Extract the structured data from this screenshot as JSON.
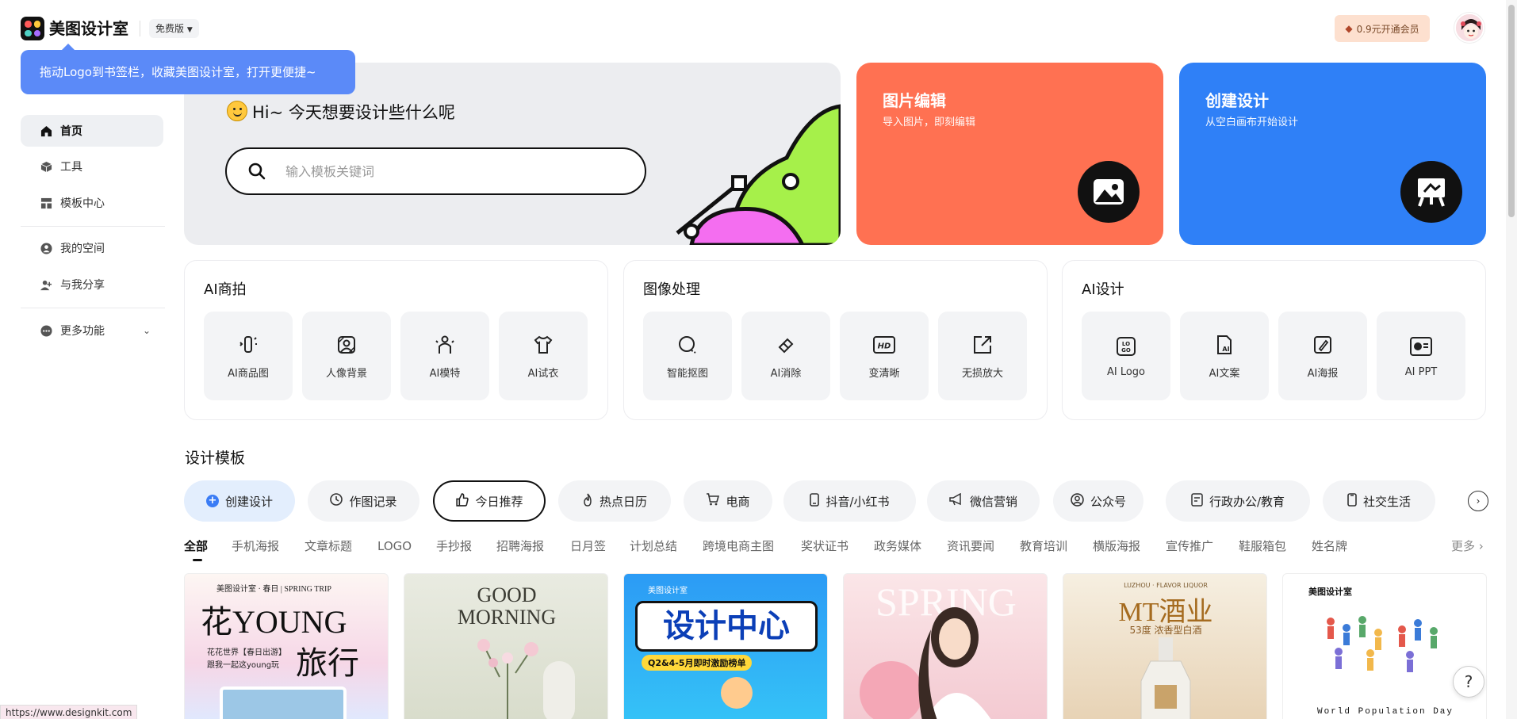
{
  "header": {
    "app_name": "美图设计室",
    "plan_badge": "免费版",
    "vip_button": "0.9元开通会员",
    "tooltip": "拖动Logo到书签栏，收藏美图设计室，打开更便捷~"
  },
  "sidebar": {
    "items": [
      {
        "label": "首页",
        "icon": "home-icon",
        "active": true
      },
      {
        "label": "工具",
        "icon": "cube-icon",
        "active": false
      },
      {
        "label": "模板中心",
        "icon": "layout-icon",
        "active": false
      },
      {
        "label": "我的空间",
        "icon": "user-circle-icon",
        "active": false
      },
      {
        "label": "与我分享",
        "icon": "share-user-icon",
        "active": false
      },
      {
        "label": "更多功能",
        "icon": "more-icon",
        "active": false
      }
    ]
  },
  "hero": {
    "greeting": "Hi~ 今天想要设计些什么呢",
    "search_placeholder": "输入模板关键词"
  },
  "cards": {
    "edit": {
      "title": "图片编辑",
      "subtitle": "导入图片，即刻编辑",
      "color": "#ff7152"
    },
    "create": {
      "title": "创建设计",
      "subtitle": "从空白画布开始设计",
      "color": "#2f80f7"
    }
  },
  "panels": [
    {
      "title": "AI商拍",
      "tools": [
        "AI商品图",
        "人像背景",
        "AI模特",
        "AI试衣"
      ]
    },
    {
      "title": "图像处理",
      "tools": [
        "智能抠图",
        "AI消除",
        "变清晰",
        "无损放大"
      ]
    },
    {
      "title": "AI设计",
      "tools": [
        "AI Logo",
        "AI文案",
        "AI海报",
        "AI PPT"
      ]
    }
  ],
  "templates": {
    "title": "设计模板",
    "chips": [
      "创建设计",
      "作图记录",
      "今日推荐",
      "热点日历",
      "电商",
      "抖音/小红书",
      "微信营销",
      "公众号",
      "行政办公/教育",
      "社交生活"
    ],
    "tabs": [
      "全部",
      "手机海报",
      "文章标题",
      "LOGO",
      "手抄报",
      "招聘海报",
      "日月签",
      "计划总结",
      "跨境电商主图",
      "奖状证书",
      "政务媒体",
      "资讯要闻",
      "教育培训",
      "横版海报",
      "宣传推广",
      "鞋服箱包",
      "姓名牌"
    ],
    "more": "更多",
    "thumbs": [
      {
        "brand": "美图设计室 · 春日 | SPRING TRIP",
        "headline": "花YOUNG",
        "headline2": "旅行",
        "line1": "花花世界【春日出游】",
        "line2": "跟我一起这young玩"
      },
      {
        "headline": "GOOD",
        "headline2": "MORNING"
      },
      {
        "brand": "美图设计室",
        "headline": "设计中心",
        "line1": "Q2&4-5月即时激励榜单"
      },
      {
        "headline": "SPRING"
      },
      {
        "brand": "LUZHOU · FLAVOR LIQUOR",
        "headline": "MT酒业",
        "line1": "53度 浓香型白酒"
      },
      {
        "brand": "美图设计室",
        "line1": "World Population Day"
      }
    ]
  },
  "status_url": "https://www.designkit.com",
  "help_label": "?"
}
